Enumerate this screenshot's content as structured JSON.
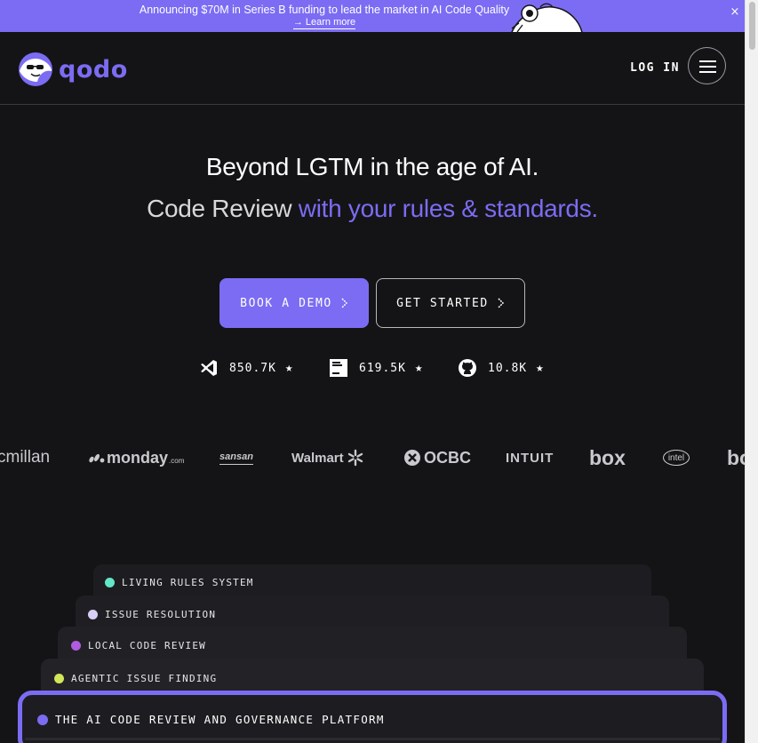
{
  "announcement": {
    "text": "Announcing $70M in Series B funding to lead the market in AI Code Quality",
    "link": "→ Learn more",
    "close": "×"
  },
  "nav": {
    "logo_text": "qodo",
    "login": "LOG IN"
  },
  "hero": {
    "line1": "Beyond LGTM in the age of AI.",
    "line2_plain": "Code Review ",
    "line2_accent": "with your rules & standards."
  },
  "buttons": {
    "demo": "BOOK A DEMO",
    "start": "GET STARTED"
  },
  "stats": [
    {
      "icon": "vscode-icon",
      "value": "850.7K"
    },
    {
      "icon": "jetbrains-icon",
      "value": "619.5K"
    },
    {
      "icon": "github-icon",
      "value": "10.8K"
    }
  ],
  "customer_logos": [
    "cmillan",
    "monday",
    ".com",
    "sansan",
    "Walmart",
    "OCBC",
    "INTUIT",
    "box",
    "intel",
    "bo"
  ],
  "features": [
    {
      "label": "LIVING RULES SYSTEM",
      "color": "#63e6c8"
    },
    {
      "label": "ISSUE RESOLUTION",
      "color": "#d8cff7"
    },
    {
      "label": "LOCAL CODE REVIEW",
      "color": "#b05be0"
    },
    {
      "label": "AGENTIC ISSUE FINDING",
      "color": "#d2e65a"
    }
  ],
  "main_card": {
    "label": "THE AI CODE REVIEW AND GOVERNANCE PLATFORM",
    "color": "#7b6cf3"
  },
  "colors": {
    "accent": "#7b6cf3",
    "background": "#141416"
  }
}
